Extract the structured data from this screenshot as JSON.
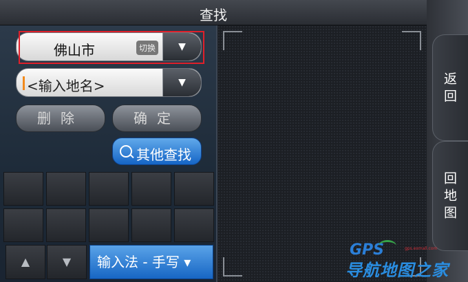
{
  "title": "查找",
  "city": {
    "name": "佛山市",
    "switch_badge": "切换",
    "dropdown_icon": "caret-down-icon"
  },
  "address": {
    "placeholder": "<输入地名>",
    "dropdown_icon": "caret-down-icon"
  },
  "buttons": {
    "delete": "删除",
    "confirm": "确定",
    "other_search": "其他查找"
  },
  "ime": {
    "label": "输入法 - 手写 ▾",
    "up": "▲",
    "down": "▼"
  },
  "sidebar": {
    "back": "返\n回",
    "back_to_map": "回\n地\n图"
  },
  "watermark": {
    "logo": "GPS",
    "brand": "导航地图之家",
    "small": "gps.exmall.com"
  },
  "colors": {
    "highlight": "#e0202a",
    "accent_blue": "#1f74d0",
    "cursor_orange": "#f28a1c"
  }
}
